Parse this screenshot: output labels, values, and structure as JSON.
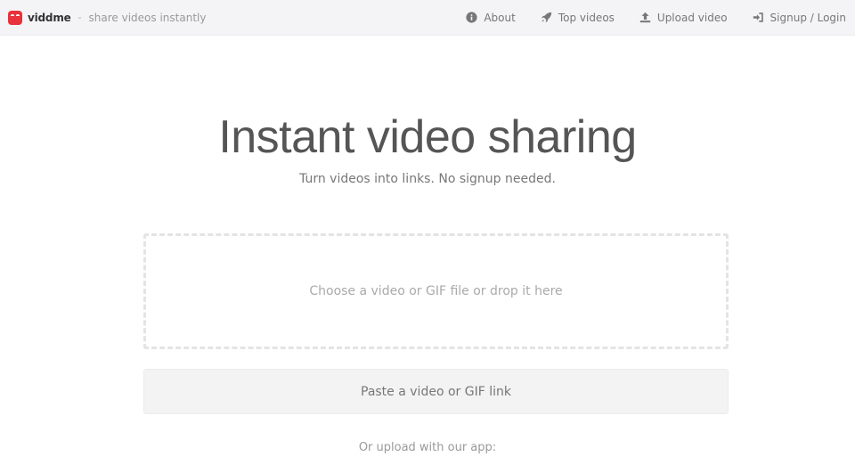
{
  "header": {
    "brand_name": "viddme",
    "separator": "-",
    "tagline": "share videos instantly",
    "nav": [
      {
        "label": "About",
        "icon": "info-icon"
      },
      {
        "label": "Top videos",
        "icon": "rocket-icon"
      },
      {
        "label": "Upload video",
        "icon": "upload-icon"
      },
      {
        "label": "Signup / Login",
        "icon": "sign-in-icon"
      }
    ]
  },
  "hero": {
    "title": "Instant video sharing",
    "subtitle": "Turn videos into links. No signup needed."
  },
  "upload": {
    "dropzone_text": "Choose a video or GIF file or drop it here",
    "paste_text": "Paste a video or GIF link",
    "app_text": "Or upload with our app:"
  },
  "colors": {
    "brand": "#e8323c",
    "topbar_bg": "#f4f4f6",
    "text": "#555555"
  }
}
